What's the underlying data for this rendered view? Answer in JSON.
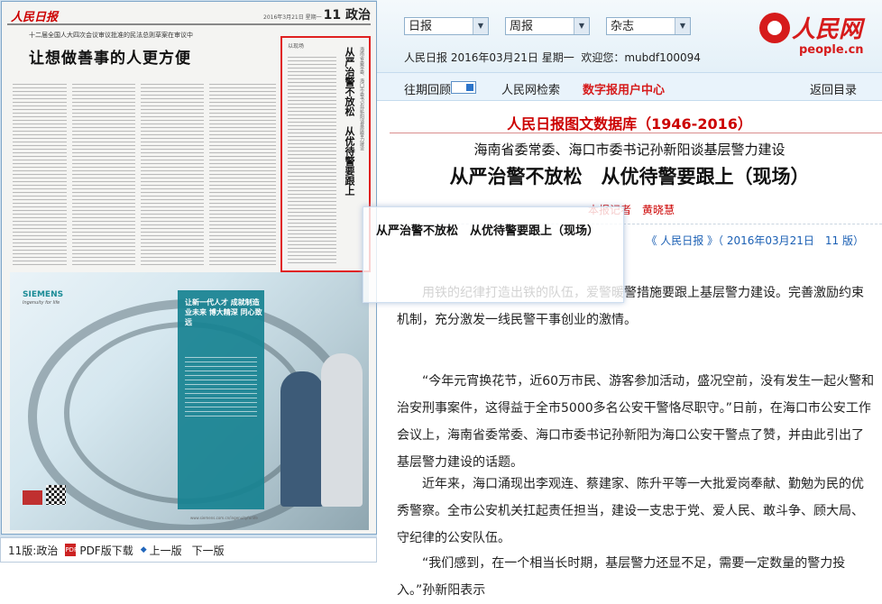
{
  "viewer": {
    "masthead": "人民日报",
    "issue_date": "2016年3月21日 星期一",
    "page_label": "11 政治",
    "kicker": "十二届全国人大四次会议审议批准的民法总则草案在审议中",
    "headline": "让想做善事的人更方便",
    "sidebar_tag": "以现场",
    "sidebar_title": "从严治警不放松　从优待警要跟上",
    "sidebar_kicker": "海南省委常委、海口市委书记孙新阳谈基层警力建设",
    "ad": {
      "brand": "SIEMENS",
      "brand_tagline": "Ingenuity for life",
      "panel_text": "让新一代人才 成就制造业未来 博大精深 同心致远",
      "url": "www.siemens.com.cn/ingenuityforlife"
    },
    "nav": {
      "page_name": "11版:政治",
      "pdf_label": "PDF版下载",
      "prev_label": "上一版",
      "next_label": "下一版"
    }
  },
  "header": {
    "selects": [
      "日报",
      "周报",
      "杂志"
    ],
    "info": "人民日报 2016年03月21日 星期一",
    "welcome": "欢迎您：mubdf100094",
    "brand_name": "人民网",
    "brand_site": "people.cn"
  },
  "navbar": {
    "history": "往期回顾",
    "search": "人民网检索",
    "user_center": "数字报用户中心",
    "back": "返回目录"
  },
  "article": {
    "database_title": "人民日报图文数据库（1946-2016）",
    "subtitle": "海南省委常委、海口市委书记孙新阳谈基层警力建设",
    "title": "从严治警不放松　从优待警要跟上（现场）",
    "author": "本报记者　黄晓慧",
    "source": "《 人民日报 》（ 2016年03月21日　11 版）",
    "paragraphs": [
      "用铁的纪律打造出铁的队伍，爱警暖警措施要跟上基层警力建设。完善激励约束机制，充分激发一线民警干事创业的激情。",
      "“今年元宵换花节，近60万市民、游客参加活动，盛况空前，没有发生一起火警和治安刑事案件，这得益于全市5000多名公安干警恪尽职守。”日前，在海口市公安工作会议上，海南省委常委、海口市委书记孙新阳为海口公安干警点了赞，并由此引出了基层警力建设的话题。",
      "近年来，海口涌现出李观连、蔡建家、陈升平等一大批爱岗奉献、勤勉为民的优秀警察。全市公安机关扛起责任担当，建设一支忠于党、爱人民、敢斗争、顾大局、守纪律的公安队伍。",
      "“我们感到，在一个相当长时期，基层警力还显不足，需要一定数量的警力投入。”孙新阳表示"
    ]
  },
  "tooltip": {
    "text": "从严治警不放松　从优待警要跟上（现场）"
  },
  "colors": {
    "accent_red": "#d61b1b",
    "link_blue": "#1a5fb4",
    "highlight_box": "#e02020"
  }
}
